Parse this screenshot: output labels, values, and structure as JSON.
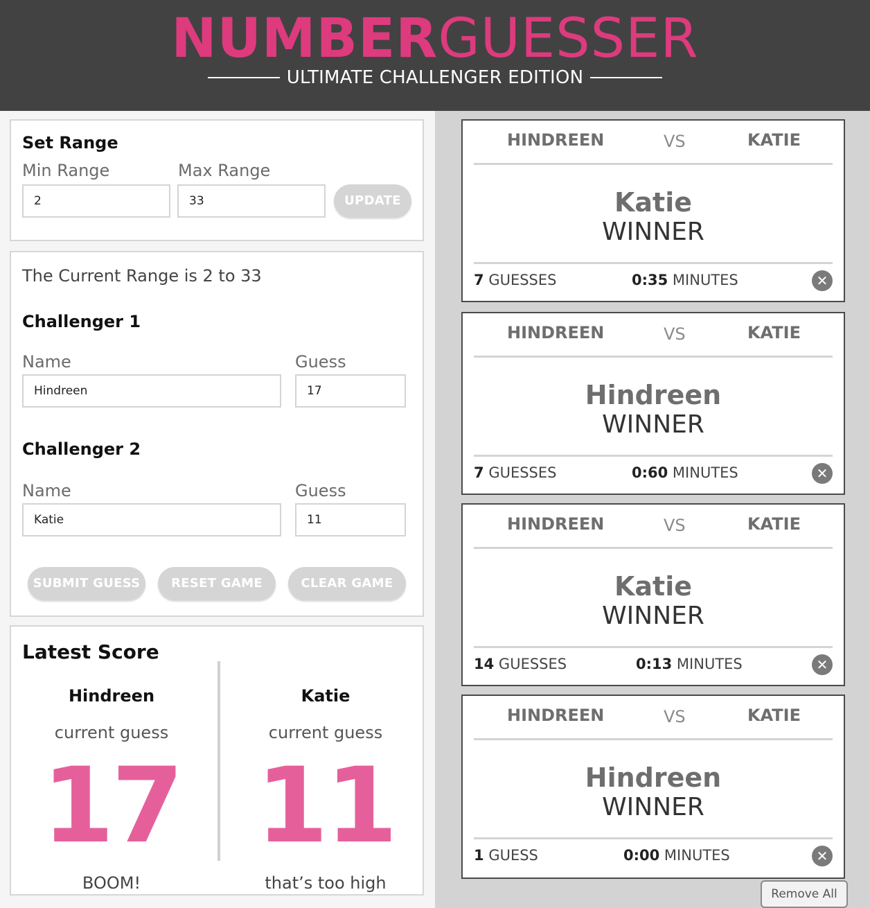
{
  "header": {
    "title_bold": "NUMBER",
    "title_light": "GUESSER",
    "subtitle": "ULTIMATE CHALLENGER EDITION"
  },
  "set_range": {
    "heading": "Set Range",
    "min_label": "Min Range",
    "max_label": "Max Range",
    "min_value": "2",
    "max_value": "33",
    "update_label": "UPDATE"
  },
  "challengers": {
    "current_range_text": "The Current Range is 2 to 33",
    "challenger1": {
      "heading": "Challenger 1",
      "name_label": "Name",
      "guess_label": "Guess",
      "name_value": "Hindreen",
      "guess_value": "17"
    },
    "challenger2": {
      "heading": "Challenger 2",
      "name_label": "Name",
      "guess_label": "Guess",
      "name_value": "Katie",
      "guess_value": "11"
    },
    "submit_label": "SUBMIT GUESS",
    "reset_label": "RESET GAME",
    "clear_label": "CLEAR GAME"
  },
  "latest_score": {
    "heading": "Latest Score",
    "players": [
      {
        "name": "Hindreen",
        "caption": "current guess",
        "guess": "17",
        "feedback": "BOOM!"
      },
      {
        "name": "Katie",
        "caption": "current guess",
        "guess": "11",
        "feedback": "that’s too high"
      }
    ]
  },
  "results": {
    "cards": [
      {
        "player1": "HINDREEN",
        "vs": "VS",
        "player2": "KATIE",
        "winner": "Katie",
        "winner_label": "WINNER",
        "guess_count": "7",
        "guess_word": "GUESSES",
        "time": "0:35",
        "time_unit": "MINUTES",
        "close_glyph": "✕"
      },
      {
        "player1": "HINDREEN",
        "vs": "VS",
        "player2": "KATIE",
        "winner": "Hindreen",
        "winner_label": "WINNER",
        "guess_count": "7",
        "guess_word": "GUESSES",
        "time": "0:60",
        "time_unit": "MINUTES",
        "close_glyph": "✕"
      },
      {
        "player1": "HINDREEN",
        "vs": "VS",
        "player2": "KATIE",
        "winner": "Katie",
        "winner_label": "WINNER",
        "guess_count": "14",
        "guess_word": "GUESSES",
        "time": "0:13",
        "time_unit": "MINUTES",
        "close_glyph": "✕"
      },
      {
        "player1": "HINDREEN",
        "vs": "VS",
        "player2": "KATIE",
        "winner": "Hindreen",
        "winner_label": "WINNER",
        "guess_count": "1",
        "guess_word": "GUESS",
        "time": "0:00",
        "time_unit": "MINUTES",
        "close_glyph": "✕"
      }
    ],
    "remove_all_label": "Remove All"
  },
  "colors": {
    "brand_pink": "#dd3b7e",
    "score_pink": "#e5609b",
    "header_bg": "#424242",
    "button_disabled": "#d5d5d5"
  }
}
